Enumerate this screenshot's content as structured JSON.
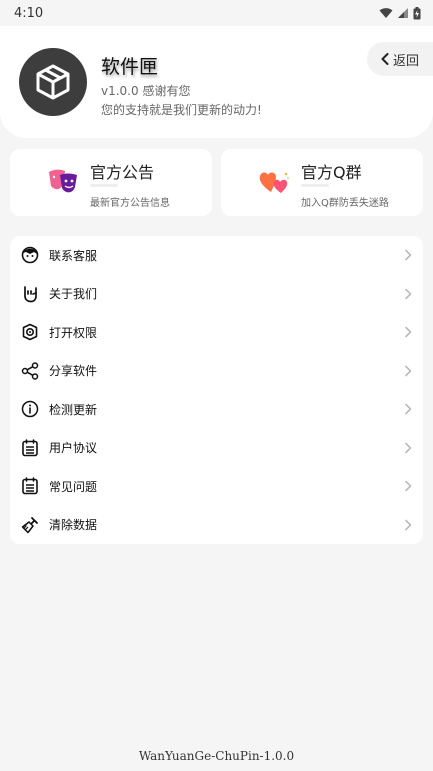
{
  "status_bar": {
    "time": "4:10"
  },
  "header": {
    "app_name": "软件匣",
    "version": "v1.0.0  感谢有您",
    "slogan": "您的支持就是我们更新的动力!",
    "back_label": "返回"
  },
  "cards": [
    {
      "title": "官方公告",
      "subtitle": "最新官方公告信息",
      "icon": "theater-masks-icon"
    },
    {
      "title": "官方Q群",
      "subtitle": "加入Q群防丢失迷路",
      "icon": "hearts-icon"
    }
  ],
  "menu": {
    "items": [
      {
        "label": "联系客服",
        "icon": "smiley-face-icon"
      },
      {
        "label": "关于我们",
        "icon": "rock-hand-icon"
      },
      {
        "label": "打开权限",
        "icon": "shield-gear-icon"
      },
      {
        "label": "分享软件",
        "icon": "share-icon"
      },
      {
        "label": "检测更新",
        "icon": "info-icon"
      },
      {
        "label": "用户协议",
        "icon": "document-icon"
      },
      {
        "label": "常见问题",
        "icon": "document-icon"
      },
      {
        "label": "清除数据",
        "icon": "broom-icon"
      }
    ]
  },
  "footer": {
    "text": "WanYuanGe-ChuPin-1.0.0"
  },
  "colors": {
    "background": "#f5f5f5",
    "card": "#ffffff",
    "logo": "#3d3d3d",
    "mask_pink": "#f06292",
    "mask_purple": "#6a1b9a",
    "heart_orange": "#ff7043"
  }
}
